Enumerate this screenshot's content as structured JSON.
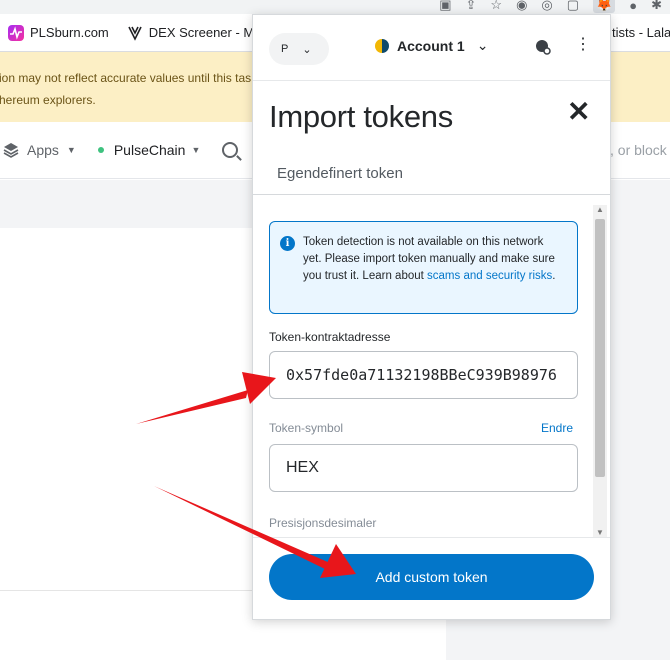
{
  "browser": {
    "bookmarks": [
      {
        "label": "PLSburn.com",
        "icon": "pulse-icon"
      },
      {
        "label": "DEX Screener - Mul...",
        "icon": "dexscreener-icon"
      }
    ],
    "bookmark_right": "tists - Lalals"
  },
  "banner": {
    "line1": "ion may not reflect accurate values until this tas",
    "line2": "hereum explorers."
  },
  "appnav": {
    "apps_label": "Apps",
    "chain_label": "PulseChain",
    "search_tail": ", or block"
  },
  "popup": {
    "network_label": "P",
    "account_label": "Account 1",
    "title": "Import tokens",
    "tab_label": "Egendefinert token",
    "info_text": "Token detection is not available on this network yet. Please import token manually and make sure you trust it. Learn about ",
    "info_link": "scams and security risks",
    "info_suffix": ".",
    "address_label": "Token-kontraktadresse",
    "address_value": "0x57fde0a71132198BBeC939B98976",
    "symbol_label": "Token-symbol",
    "edit_label": "Endre",
    "symbol_value": "HEX",
    "decimals_label": "Presisjonsdesimaler",
    "add_button": "Add custom token"
  },
  "colors": {
    "accent": "#0376c9",
    "banner_bg": "#fcefc5",
    "arrow": "#e8161b"
  }
}
